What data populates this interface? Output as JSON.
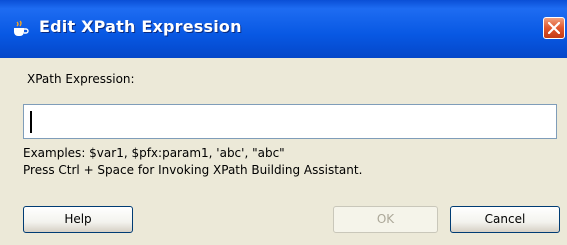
{
  "window": {
    "title": "Edit XPath Expression"
  },
  "form": {
    "field_label": "XPath Expression:",
    "field_value": "",
    "examples": "Examples: $var1, $pfx:param1, 'abc', \"abc\"",
    "assistant_hint": "Press Ctrl + Space for Invoking XPath Building Assistant."
  },
  "buttons": {
    "help": "Help",
    "ok": "OK",
    "cancel": "Cancel"
  }
}
